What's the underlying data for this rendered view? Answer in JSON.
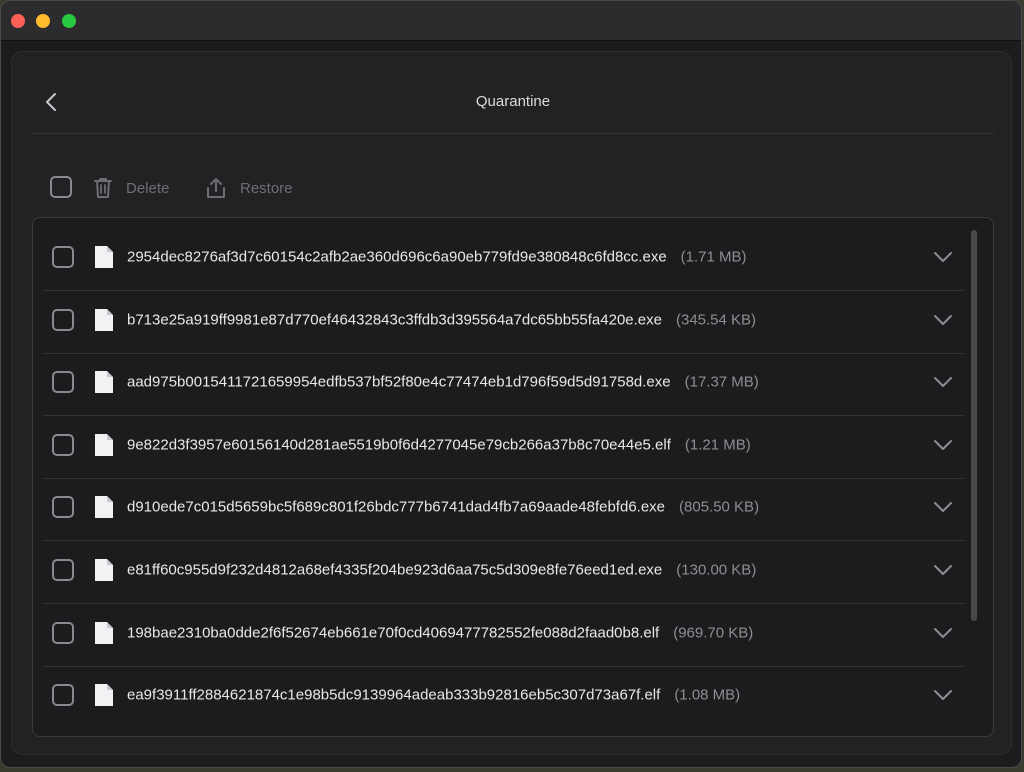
{
  "header": {
    "title": "Quarantine",
    "back_icon": "chevron-left-icon"
  },
  "toolbar": {
    "delete_label": "Delete",
    "restore_label": "Restore",
    "delete_icon": "trash-icon",
    "restore_icon": "upload-icon"
  },
  "files": [
    {
      "name": "2954dec8276af3d7c60154c2afb2ae360d696c6a90eb779fd9e380848c6fd8cc.exe",
      "size": "(1.71 MB)"
    },
    {
      "name": "b713e25a919ff9981e87d770ef46432843c3ffdb3d395564a7dc65bb55fa420e.exe",
      "size": "(345.54 KB)"
    },
    {
      "name": "aad975b0015411721659954edfb537bf52f80e4c77474eb1d796f59d5d91758d.exe",
      "size": "(17.37 MB)"
    },
    {
      "name": "9e822d3f3957e60156140d281ae5519b0f6d4277045e79cb266a37b8c70e44e5.elf",
      "size": "(1.21 MB)"
    },
    {
      "name": "d910ede7c015d5659bc5f689c801f26bdc777b6741dad4fb7a69aade48febfd6.exe",
      "size": "(805.50 KB)"
    },
    {
      "name": "e81ff60c955d9f232d4812a68ef4335f204be923d6aa75c5d309e8fe76eed1ed.exe",
      "size": "(130.00 KB)"
    },
    {
      "name": "198bae2310ba0dde2f6f52674eb661e70f0cd4069477782552fe088d2faad0b8.elf",
      "size": "(969.70 KB)"
    },
    {
      "name": "ea9f3911ff2884621874c1e98b5dc9139964adeab333b92816eb5c307d73a67f.elf",
      "size": "(1.08 MB)"
    }
  ],
  "colors": {
    "accent_close": "#fe5f57",
    "accent_min": "#febc2e",
    "accent_max": "#28c840"
  }
}
